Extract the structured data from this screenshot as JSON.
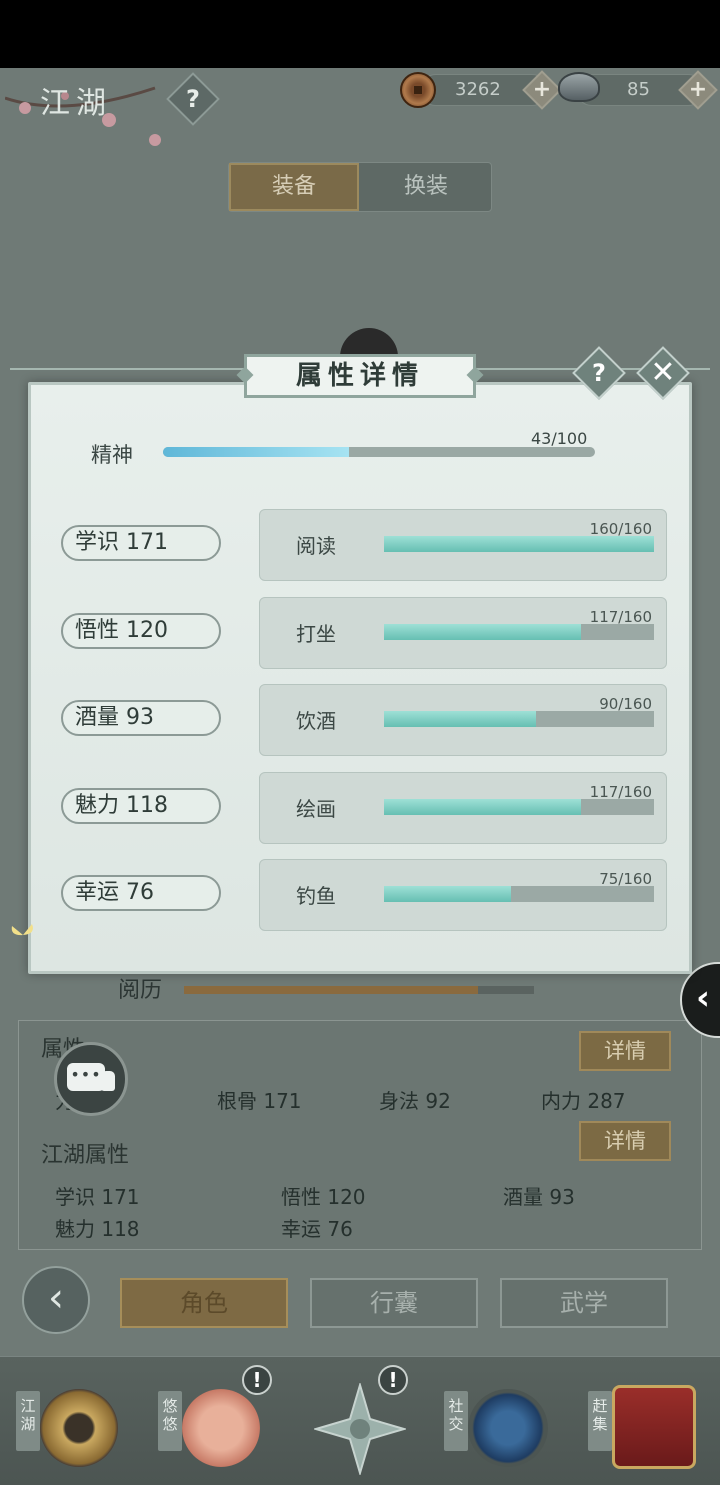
{
  "header": {
    "title": "江湖",
    "help_label": "?",
    "copper": "3262",
    "silver": "85",
    "plus": "+"
  },
  "tabs": [
    {
      "label": "装备",
      "active": true
    },
    {
      "label": "换装",
      "active": false
    }
  ],
  "modal": {
    "title": "属性详情",
    "help_label": "?",
    "close_label": "✕",
    "spirit": {
      "label": "精神",
      "value": "43/100",
      "progress": 0.43
    },
    "rows": [
      {
        "attr": "学识  171",
        "skill": "阅读",
        "value": "160/160",
        "progress": 1.0
      },
      {
        "attr": "悟性  120",
        "skill": "打坐",
        "value": "117/160",
        "progress": 0.731
      },
      {
        "attr": "酒量  93",
        "skill": "饮酒",
        "value": "90/160",
        "progress": 0.5625
      },
      {
        "attr": "魅力  118",
        "skill": "绘画",
        "value": "117/160",
        "progress": 0.731
      },
      {
        "attr": "幸运  76",
        "skill": "钓鱼",
        "value": "75/160",
        "progress": 0.469
      }
    ]
  },
  "lower": {
    "exp_label": "阅历",
    "exp_progress": 0.84,
    "attributes_title": "属性",
    "detail_label": "详情",
    "base_stats": [
      "力 96",
      "根骨  171",
      "身法  92",
      "内力  287"
    ],
    "jianghu_title": "江湖属性",
    "jianghu_stats": [
      "学识  171",
      "悟性  120",
      "酒量  93",
      "魅力  118",
      "幸运  76"
    ]
  },
  "nav": {
    "back": "‹",
    "buttons": [
      {
        "label": "角色",
        "active": true
      },
      {
        "label": "行囊",
        "active": false
      },
      {
        "label": "武学",
        "active": false
      }
    ]
  },
  "dock": {
    "items": [
      {
        "label": "江湖",
        "alert": false
      },
      {
        "label": "悠悠",
        "alert": true
      },
      {
        "label": "",
        "alert": true
      },
      {
        "label": "社交",
        "alert": false
      },
      {
        "label": "赶集",
        "alert": false
      }
    ],
    "alert_mark": "!"
  },
  "side_arrow": "‹",
  "colors": {
    "accent_gold": "#7c6a44",
    "progress_teal": "#66bfb2",
    "spirit_blue": "#5fb7d8"
  }
}
